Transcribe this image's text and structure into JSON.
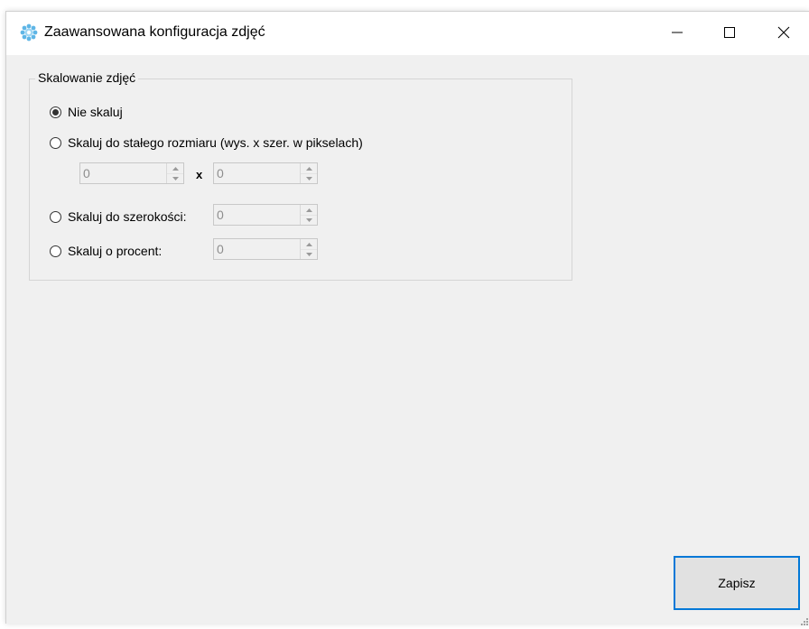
{
  "window": {
    "title": "Zaawansowana konfiguracja zdjęć",
    "icon": "gear-flower-icon",
    "accent_color": "#0078d7"
  },
  "scaling": {
    "group_label": "Skalowanie zdjęć",
    "options": [
      {
        "label": "Nie skaluj",
        "checked": true
      },
      {
        "label": "Skaluj do stałego rozmiaru (wys. x szer. w pikselach)",
        "checked": false
      },
      {
        "label": "Skaluj do szerokości:",
        "checked": false
      },
      {
        "label": "Skaluj o procent:",
        "checked": false
      }
    ],
    "fixed_height_value": "0",
    "fixed_width_value": "0",
    "separator": "x",
    "width_value": "0",
    "percent_value": "0"
  },
  "save_button": {
    "label": "Zapisz"
  }
}
